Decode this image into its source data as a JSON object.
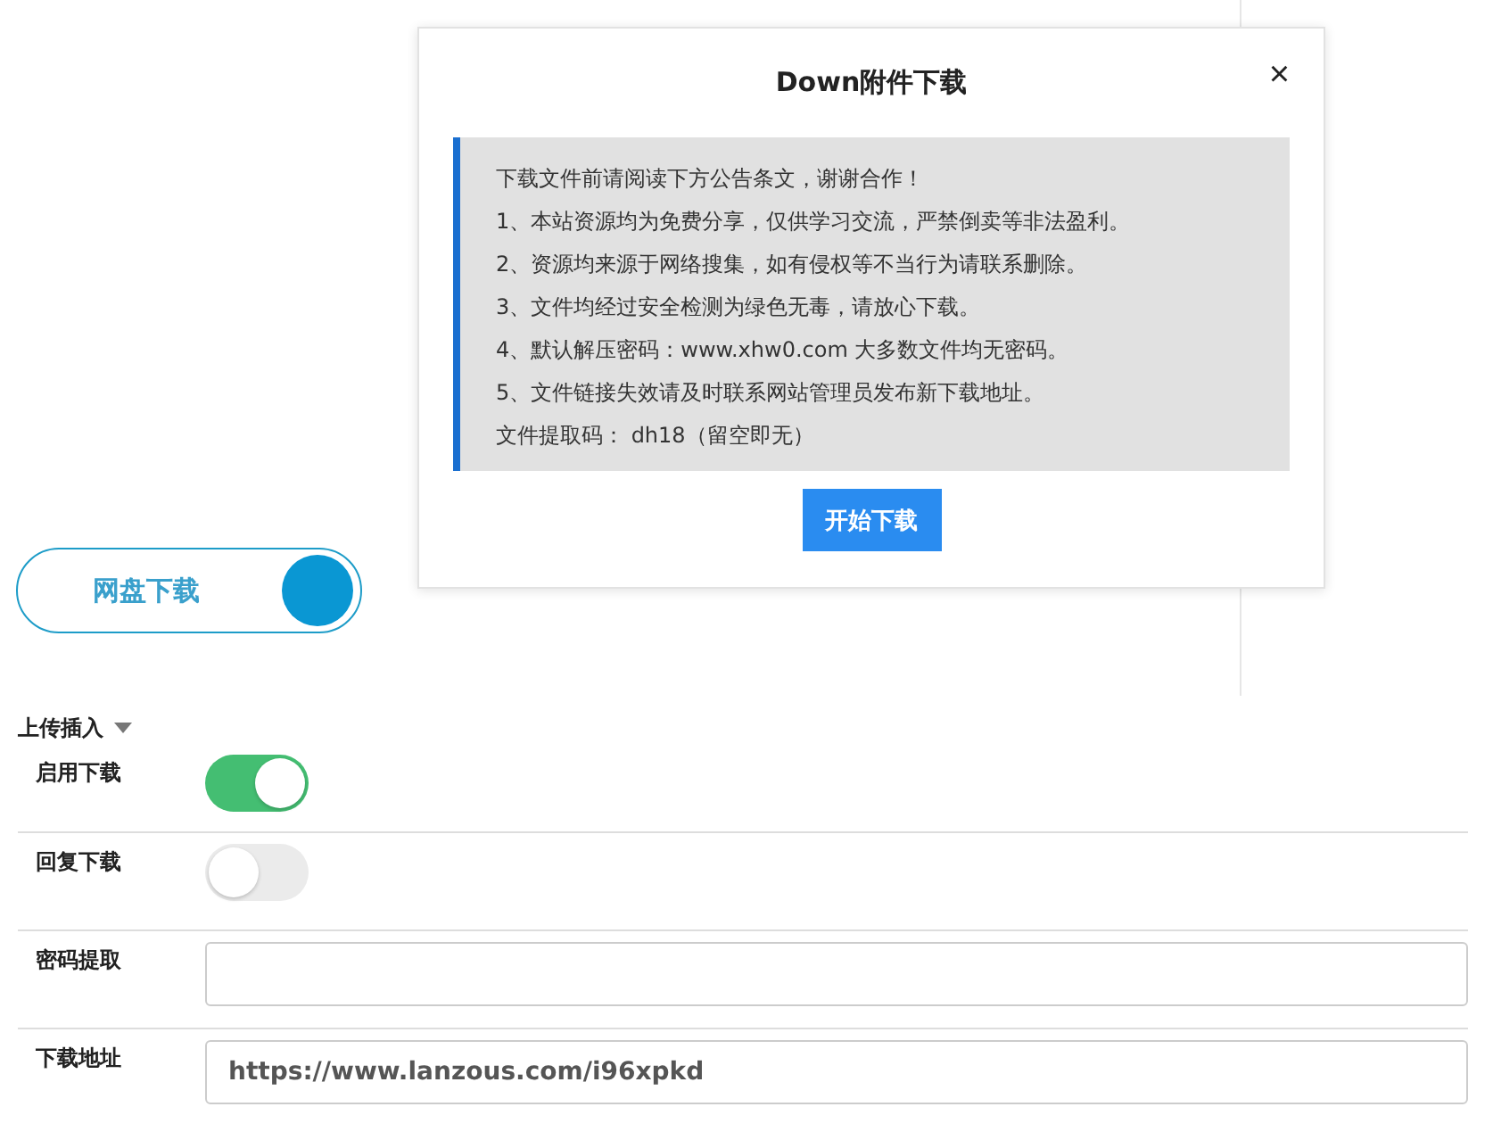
{
  "netdisk_button": {
    "label": "网盘下载"
  },
  "settings": {
    "title": "上传插入",
    "rows": [
      {
        "kind": "toggle",
        "label": "启用下载",
        "on": true
      },
      {
        "kind": "toggle",
        "label": "回复下载",
        "on": false
      },
      {
        "kind": "input",
        "label": "密码提取",
        "value": ""
      },
      {
        "kind": "input",
        "label": "下载地址",
        "value": "https://www.lanzous.com/i96xpkd"
      }
    ]
  },
  "dialog": {
    "title": "Down附件下载",
    "close": "×",
    "notice": [
      "下载文件前请阅读下方公告条文，谢谢合作！",
      "1、本站资源均为免费分享，仅供学习交流，严禁倒卖等非法盈利。",
      "2、资源均来源于网络搜集，如有侵权等不当行为请联系删除。",
      "3、文件均经过安全检测为绿色无毒，请放心下载。",
      "4、默认解压密码：www.xhw0.com 大多数文件均无密码。",
      "5、文件链接失效请及时联系网站管理员发布新下载地址。",
      "文件提取码： dh18（留空即无）"
    ],
    "button": "开始下载"
  }
}
